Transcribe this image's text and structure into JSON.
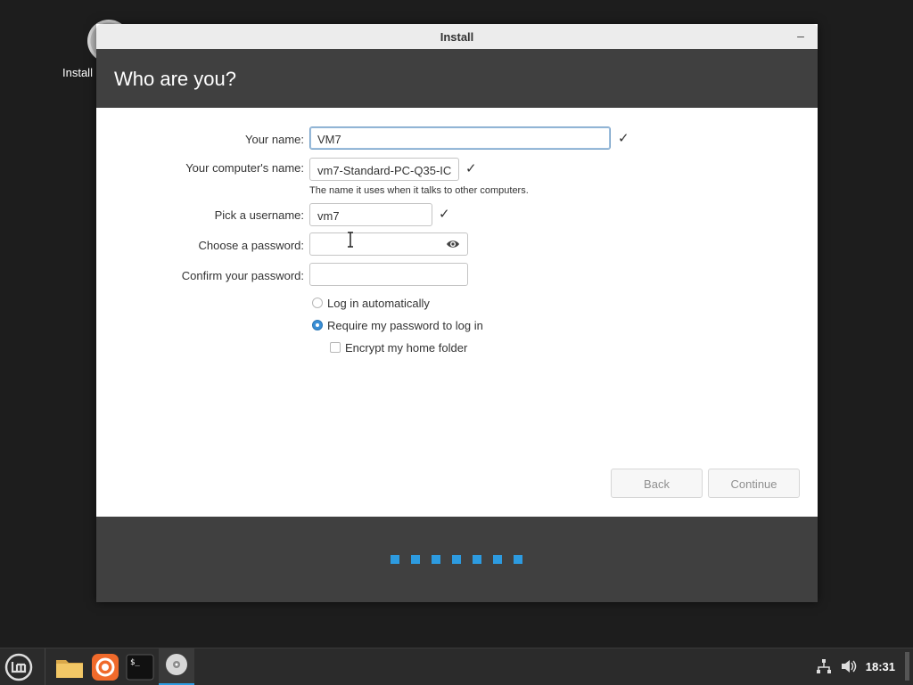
{
  "desktop": {
    "icon_label": "Install"
  },
  "window": {
    "title": "Install",
    "minimize": "–",
    "header": "Who are you?"
  },
  "form": {
    "your_name_label": "Your name:",
    "your_name_value": "VM7",
    "computer_name_label": "Your computer's name:",
    "computer_name_value": "vm7-Standard-PC-Q35-IC",
    "computer_name_hint": "The name it uses when it talks to other computers.",
    "username_label": "Pick a username:",
    "username_value": "vm7",
    "password_label": "Choose a password:",
    "confirm_label": "Confirm your password:",
    "check_mark": "✓"
  },
  "options": {
    "login_auto": "Log in automatically",
    "require_password": "Require my password to log in",
    "encrypt_home": "Encrypt my home folder"
  },
  "buttons": {
    "back": "Back",
    "continue": "Continue"
  },
  "progress": {
    "total_steps": 7
  },
  "taskbar": {
    "clock": "18:31"
  },
  "colors": {
    "accent": "#2d9be0",
    "header_bg": "#404040"
  }
}
